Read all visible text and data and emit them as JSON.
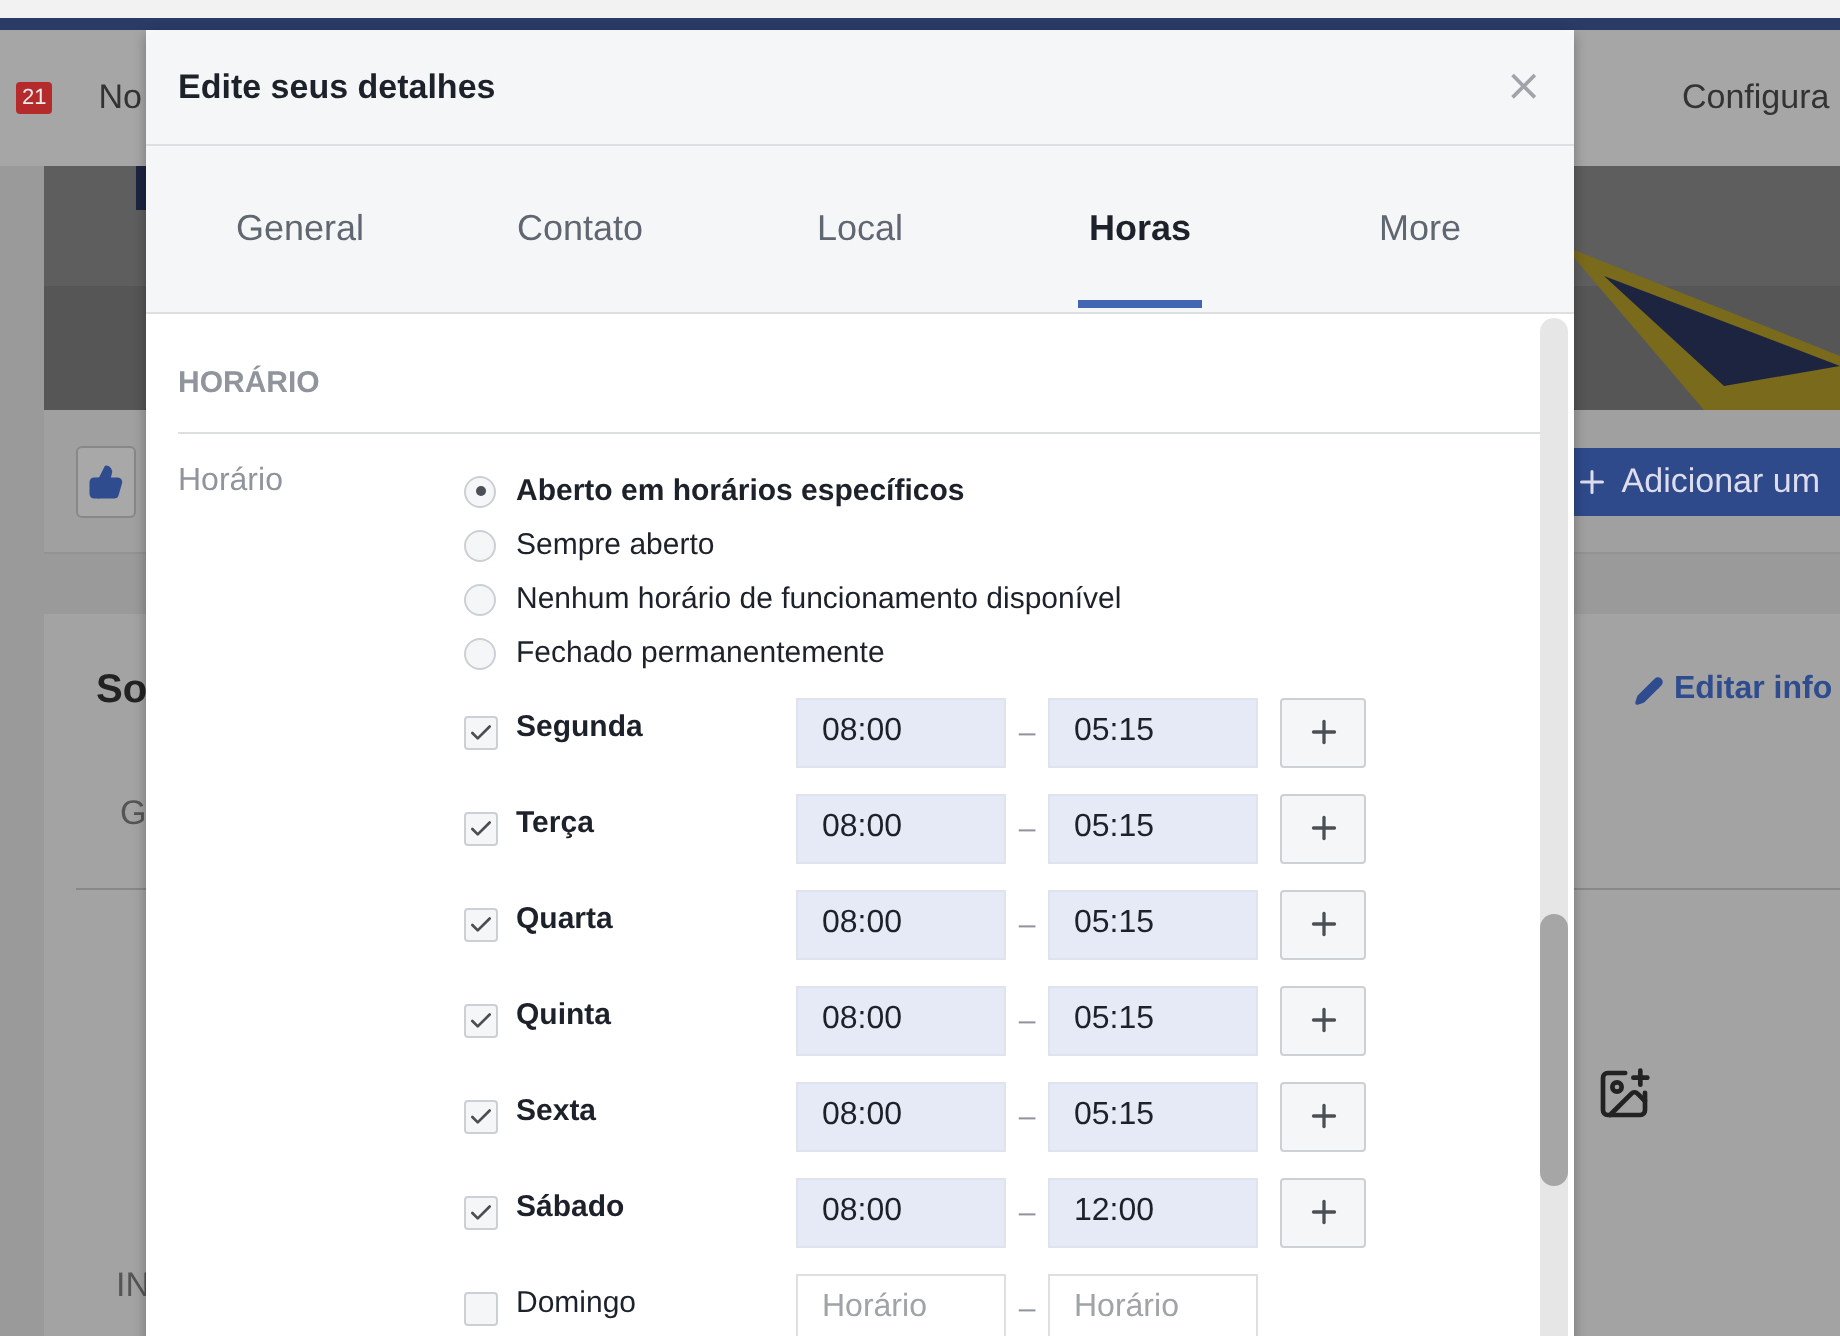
{
  "background": {
    "notification_count": "21",
    "nav_left": "No",
    "nav_right": "Configura",
    "add_button": "Adicionar um",
    "card_title": "So",
    "edit_link": "Editar info",
    "card_tab": "G",
    "card_section": "IN"
  },
  "dialog": {
    "title": "Edite seus detalhes",
    "close": "×",
    "tabs": [
      {
        "label": "General",
        "selected": false
      },
      {
        "label": "Contato",
        "selected": false
      },
      {
        "label": "Local",
        "selected": false
      },
      {
        "label": "Horas",
        "selected": true
      },
      {
        "label": "More",
        "selected": false
      }
    ],
    "section": "HORÁRIO",
    "field_label": "Horário",
    "options": [
      {
        "label": "Aberto em horários específicos",
        "selected": true
      },
      {
        "label": "Sempre aberto",
        "selected": false
      },
      {
        "label": "Nenhum horário de funcionamento disponível",
        "selected": false
      },
      {
        "label": "Fechado permanentemente",
        "selected": false
      }
    ],
    "days": [
      {
        "name": "Segunda",
        "checked": true,
        "open": "08:00",
        "dash": "–",
        "close": "05:15"
      },
      {
        "name": "Terça",
        "checked": true,
        "open": "08:00",
        "dash": "–",
        "close": "05:15"
      },
      {
        "name": "Quarta",
        "checked": true,
        "open": "08:00",
        "dash": "–",
        "close": "05:15"
      },
      {
        "name": "Quinta",
        "checked": true,
        "open": "08:00",
        "dash": "–",
        "close": "05:15"
      },
      {
        "name": "Sexta",
        "checked": true,
        "open": "08:00",
        "dash": "–",
        "close": "05:15"
      },
      {
        "name": "Sábado",
        "checked": true,
        "open": "08:00",
        "dash": "–",
        "close": "12:00"
      },
      {
        "name": "Domingo",
        "checked": false,
        "open_placeholder": "Horário",
        "dash": "–",
        "close_placeholder": "Horário"
      }
    ]
  }
}
